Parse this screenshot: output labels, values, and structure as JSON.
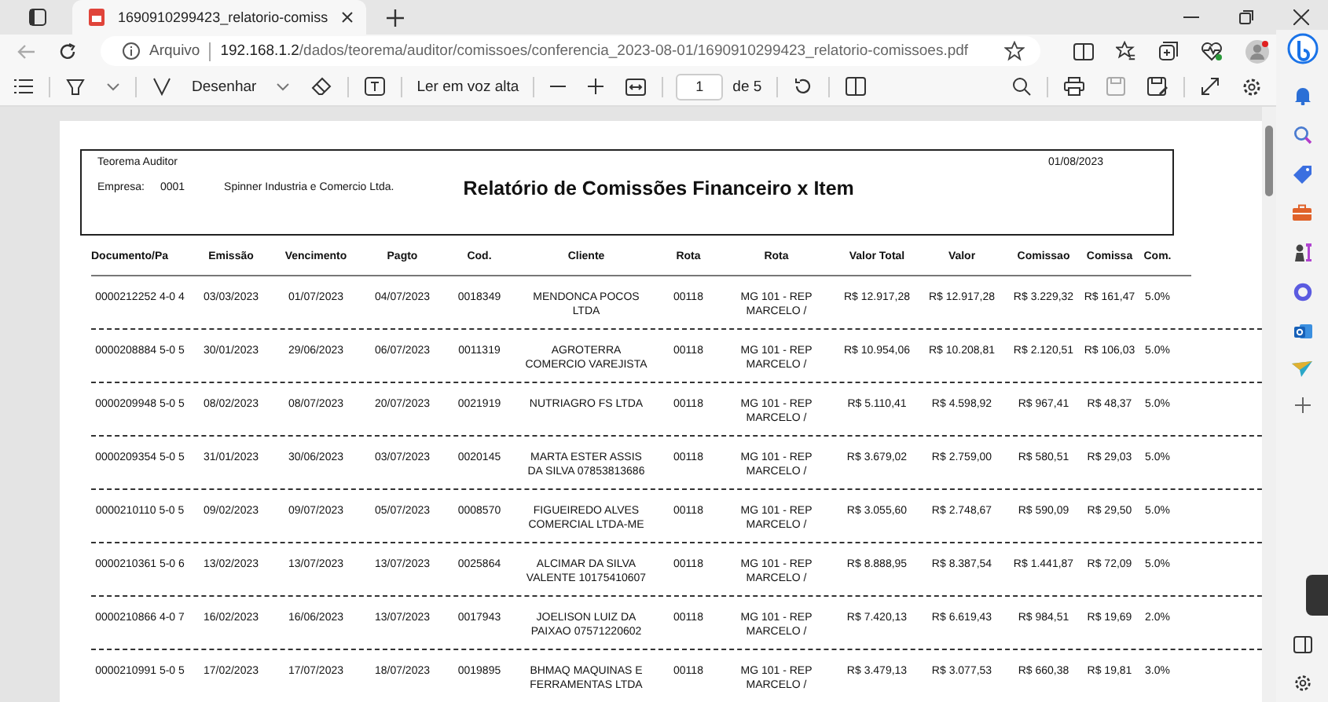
{
  "tab": {
    "title": "1690910299423_relatorio-comiss"
  },
  "address": {
    "scheme": "Arquivo",
    "host": "192.168.1.2",
    "path": "/dados/teorema/auditor/comissoes/conferencia_2023-08-01/1690910299423_relatorio-comissoes.pdf"
  },
  "pdf_toolbar": {
    "draw": "Desenhar",
    "read_aloud": "Ler em voz alta",
    "page": "1",
    "page_count": "de 5"
  },
  "report": {
    "company_name": "Teorema Auditor",
    "date": "01/08/2023",
    "empresa_label": "Empresa:",
    "empresa_code": "0001",
    "empresa_name": "Spinner Industria e Comercio Ltda.",
    "title": "Relatório de Comissões Financeiro x Item",
    "columns": [
      "Documento/Pa",
      "Emissão",
      "Vencimento",
      "Pagto",
      "Cod.",
      "Cliente",
      "Rota",
      "Rota",
      "Valor Total",
      "Valor",
      "Comissao",
      "Comissa",
      "Com."
    ],
    "rows": [
      [
        "0000212252 4-0 4",
        "03/03/2023",
        "01/07/2023",
        "04/07/2023",
        "0018349",
        "MENDONCA POCOS\nLTDA",
        "00118",
        "MG 101 - REP\nMARCELO /",
        "R$ 12.917,28",
        "R$ 12.917,28",
        "R$ 3.229,32",
        "R$ 161,47",
        "5.0%"
      ],
      [
        "0000208884 5-0 5",
        "30/01/2023",
        "29/06/2023",
        "06/07/2023",
        "0011319",
        "AGROTERRA\nCOMERCIO VAREJISTA",
        "00118",
        "MG 101 - REP\nMARCELO /",
        "R$ 10.954,06",
        "R$ 10.208,81",
        "R$ 2.120,51",
        "R$ 106,03",
        "5.0%"
      ],
      [
        "0000209948 5-0 5",
        "08/02/2023",
        "08/07/2023",
        "20/07/2023",
        "0021919",
        "NUTRIAGRO FS LTDA",
        "00118",
        "MG 101 - REP\nMARCELO /",
        "R$ 5.110,41",
        "R$ 4.598,92",
        "R$ 967,41",
        "R$ 48,37",
        "5.0%"
      ],
      [
        "0000209354 5-0 5",
        "31/01/2023",
        "30/06/2023",
        "03/07/2023",
        "0020145",
        "MARTA ESTER ASSIS\nDA SILVA 07853813686",
        "00118",
        "MG 101 - REP\nMARCELO /",
        "R$ 3.679,02",
        "R$ 2.759,00",
        "R$ 580,51",
        "R$ 29,03",
        "5.0%"
      ],
      [
        "0000210110 5-0 5",
        "09/02/2023",
        "09/07/2023",
        "05/07/2023",
        "0008570",
        "FIGUEIREDO ALVES\nCOMERCIAL LTDA-ME",
        "00118",
        "MG 101 - REP\nMARCELO /",
        "R$ 3.055,60",
        "R$ 2.748,67",
        "R$ 590,09",
        "R$ 29,50",
        "5.0%"
      ],
      [
        "0000210361 5-0 6",
        "13/02/2023",
        "13/07/2023",
        "13/07/2023",
        "0025864",
        "ALCIMAR DA SILVA\nVALENTE 10175410607",
        "00118",
        "MG 101 - REP\nMARCELO /",
        "R$ 8.888,95",
        "R$ 8.387,54",
        "R$ 1.441,87",
        "R$ 72,09",
        "5.0%"
      ],
      [
        "0000210866 4-0 7",
        "16/02/2023",
        "16/06/2023",
        "13/07/2023",
        "0017943",
        "JOELISON LUIZ DA\nPAIXAO 07571220602",
        "00118",
        "MG 101 - REP\nMARCELO /",
        "R$ 7.420,13",
        "R$ 6.619,43",
        "R$ 984,51",
        "R$ 19,69",
        "2.0%"
      ],
      [
        "0000210991 5-0 5",
        "17/02/2023",
        "17/07/2023",
        "18/07/2023",
        "0019895",
        "BHMAQ MAQUINAS E\nFERRAMENTAS LTDA",
        "00118",
        "MG 101 - REP\nMARCELO /",
        "R$ 3.479,13",
        "R$ 3.077,53",
        "R$ 660,38",
        "R$ 19,81",
        "3.0%"
      ]
    ]
  }
}
